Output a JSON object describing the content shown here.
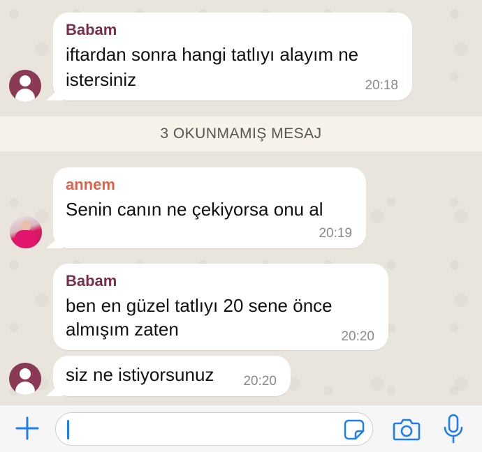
{
  "messages": [
    {
      "sender": "Babam",
      "lines": [
        "iftardan sonra hangi tatlıyı alayım ne",
        "istersiniz"
      ],
      "time": "20:18"
    },
    {
      "sender": "annem",
      "lines": [
        "Senin canın ne çekiyorsa onu al"
      ],
      "time": "20:19"
    },
    {
      "sender": "Babam",
      "lines": [
        "ben en güzel tatlıyı 20 sene önce",
        "almışım zaten"
      ],
      "time": "20:20"
    },
    {
      "sender": "",
      "lines": [
        "siz ne istiyorsunuz"
      ],
      "time": "20:20"
    }
  ],
  "unread_banner": "3 OKUNMAMIŞ MESAJ",
  "composer": {
    "placeholder": ""
  },
  "colors": {
    "babam_name": "#7b2d4b",
    "annem_name": "#e0614a",
    "accent_blue": "#1f7df2",
    "chat_background": "#e9e4dc"
  },
  "icons": [
    "person-avatar-icon",
    "plus-icon",
    "sticker-icon",
    "camera-icon",
    "microphone-icon"
  ]
}
